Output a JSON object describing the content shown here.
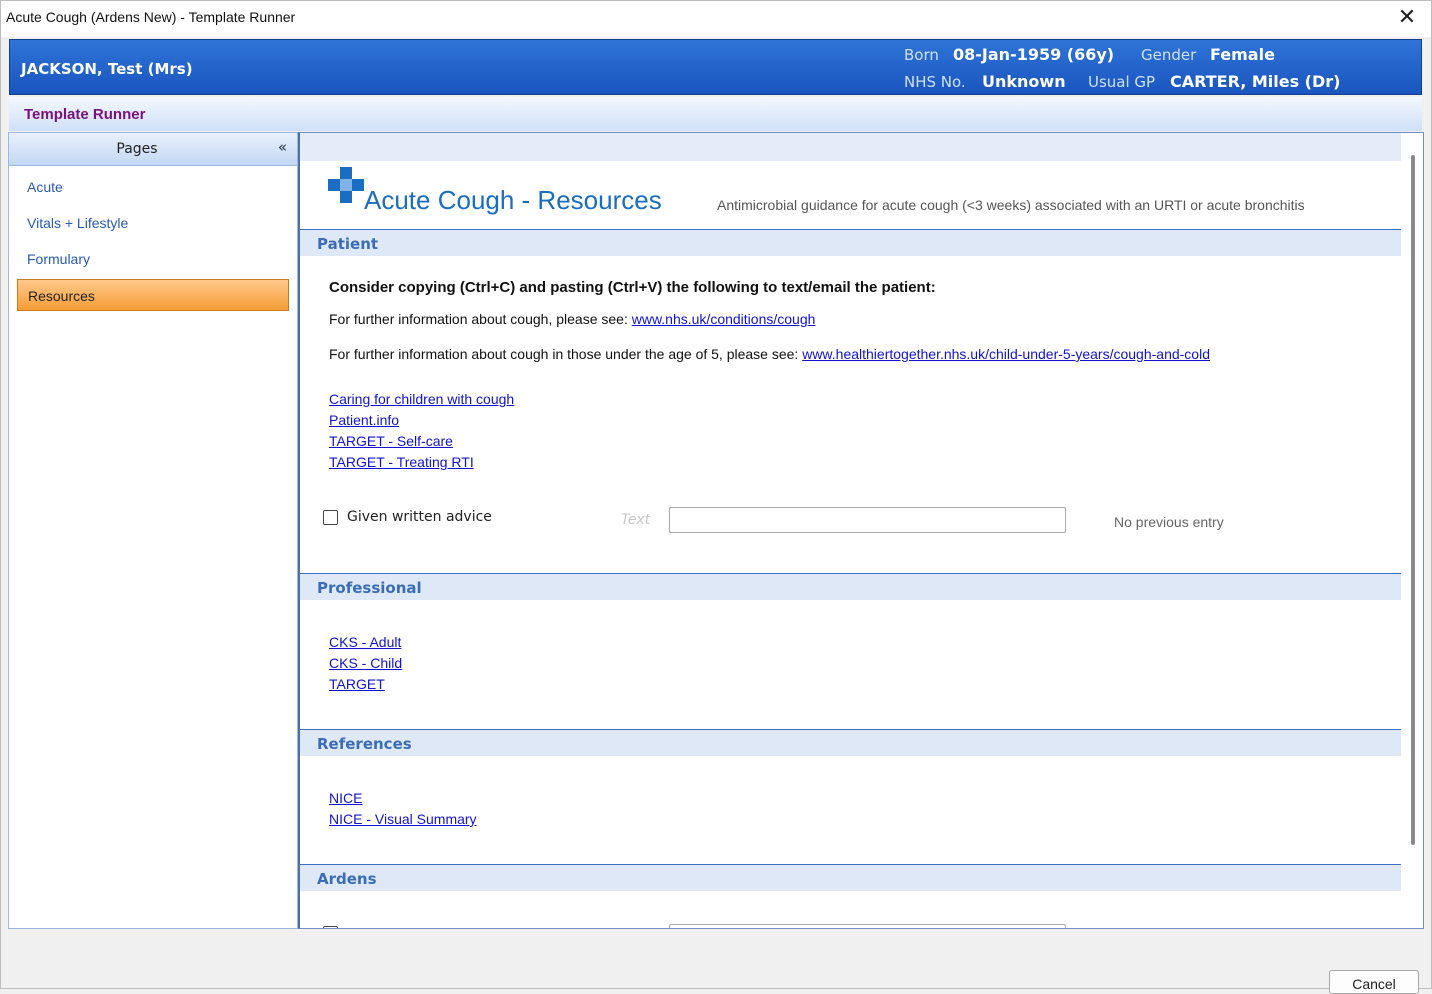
{
  "window": {
    "title": "Acute Cough (Ardens New) - Template Runner",
    "close_glyph": "✕"
  },
  "patient": {
    "name": "JACKSON, Test (Mrs)",
    "born_label": "Born",
    "born_value": "08-Jan-1959 (66y)",
    "gender_label": "Gender",
    "gender_value": "Female",
    "nhs_label": "NHS No.",
    "nhs_value": "Unknown",
    "gp_label": "Usual GP",
    "gp_value": "CARTER, Miles (Dr)"
  },
  "runner": {
    "title": "Template Runner"
  },
  "pages": {
    "header": "Pages",
    "collapse_glyph": "«",
    "items": [
      {
        "label": "Acute"
      },
      {
        "label": "Vitals + Lifestyle"
      },
      {
        "label": "Formulary"
      },
      {
        "label": "Resources",
        "active": true
      }
    ]
  },
  "content": {
    "title": "Acute Cough - Resources",
    "subtitle": "Antimicrobial guidance for acute cough (<3 weeks) associated with an URTI or acute bronchitis",
    "logo_color": "#1a6dc2",
    "patient_section": {
      "heading": "Patient",
      "instruction": "Consider copying (Ctrl+C) and pasting (Ctrl+V) the following to text/email the patient:",
      "line1_prefix": "For further information about cough, please see: ",
      "line1_link": "www.nhs.uk/conditions/cough",
      "line2_prefix": "For further information about cough in those under the age of 5, please see: ",
      "line2_link": "www.healthiertogether.nhs.uk/child-under-5-years/cough-and-cold",
      "links": [
        "Caring for children with cough",
        "Patient.info",
        "TARGET - Self-care",
        "TARGET - Treating RTI"
      ],
      "checkbox_label": "Given written advice",
      "text_placeholder": "Text",
      "text_value": "",
      "no_previous": "No previous entry"
    },
    "professional_section": {
      "heading": "Professional",
      "links": [
        "CKS - Adult",
        "CKS - Child",
        "TARGET"
      ]
    },
    "references_section": {
      "heading": "References",
      "links": [
        "NICE",
        "NICE - Visual Summary"
      ]
    },
    "ardens_section": {
      "heading": "Ardens"
    }
  },
  "footer": {
    "cancel_label": "Cancel"
  }
}
